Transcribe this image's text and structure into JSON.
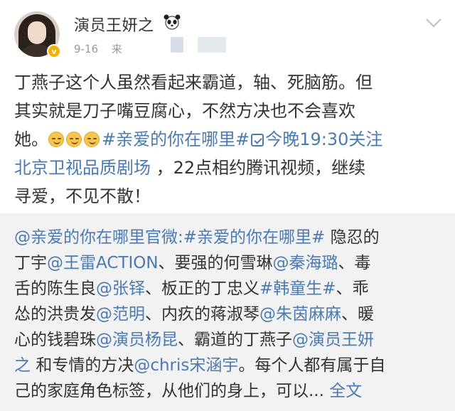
{
  "header": {
    "username": "演员王妍之",
    "date": "9-16",
    "source_prefix": "来"
  },
  "post": {
    "line1": "丁燕子这个人虽然看起来霸道，轴、死脑筋。但",
    "line2": "其实就是刀子嘴豆腐心，不然方决也不会喜欢",
    "line3_prefix": "她。",
    "topic": "#亲爱的你在哪里#",
    "schedule": "今晚19:30关注",
    "channel": "北京卫视品质剧场",
    "line4_rest": "，22点相约腾讯视频，继续",
    "line5": "寻爱，不见不散！"
  },
  "repost": {
    "author": "@亲爱的你在哪里官微",
    "colon": ":",
    "topic": "#亲爱的你在哪里#",
    "t1": "隐忍的",
    "t2": "丁宇",
    "m1": "@王雷ACTION",
    "t3": "、要强的何雪琳",
    "m2": "@秦海璐",
    "t4": "、毒",
    "t5": "舌的陈生良",
    "m3": "@张铎",
    "t6": "、板正的丁忠义",
    "topic2": "#韩童生#",
    "t7": "、乖",
    "t8": "怂的洪贵发",
    "m4": "@范明",
    "t9": "、内疚的蒋淑琴",
    "m5": "@朱茵麻麻",
    "t10": "、暖",
    "t11": "心的钱碧珠",
    "m6": "@演员杨昆",
    "t12": "、霸道的丁燕子",
    "m7": "@演员王妍",
    "m7b": "之",
    "t13": "和专情的方决",
    "m8": "@chris宋涵宇",
    "t14": "。每个人都有属于自",
    "t15": "己的家庭角色标签，从他们的身上，可以...",
    "more": "全文"
  },
  "icons": {
    "avatar": "avatar",
    "verified": "verified-badge-icon",
    "panda": "panda-icon",
    "chevron": "chevron-down-icon",
    "emoji": "smile-emoji-icon",
    "calendar": "calendar-check-icon"
  },
  "colors": {
    "link": "#4a7ab1",
    "repost_bg": "#f2f2f2",
    "meta": "#9a9a9a",
    "verified": "#f5b200"
  }
}
